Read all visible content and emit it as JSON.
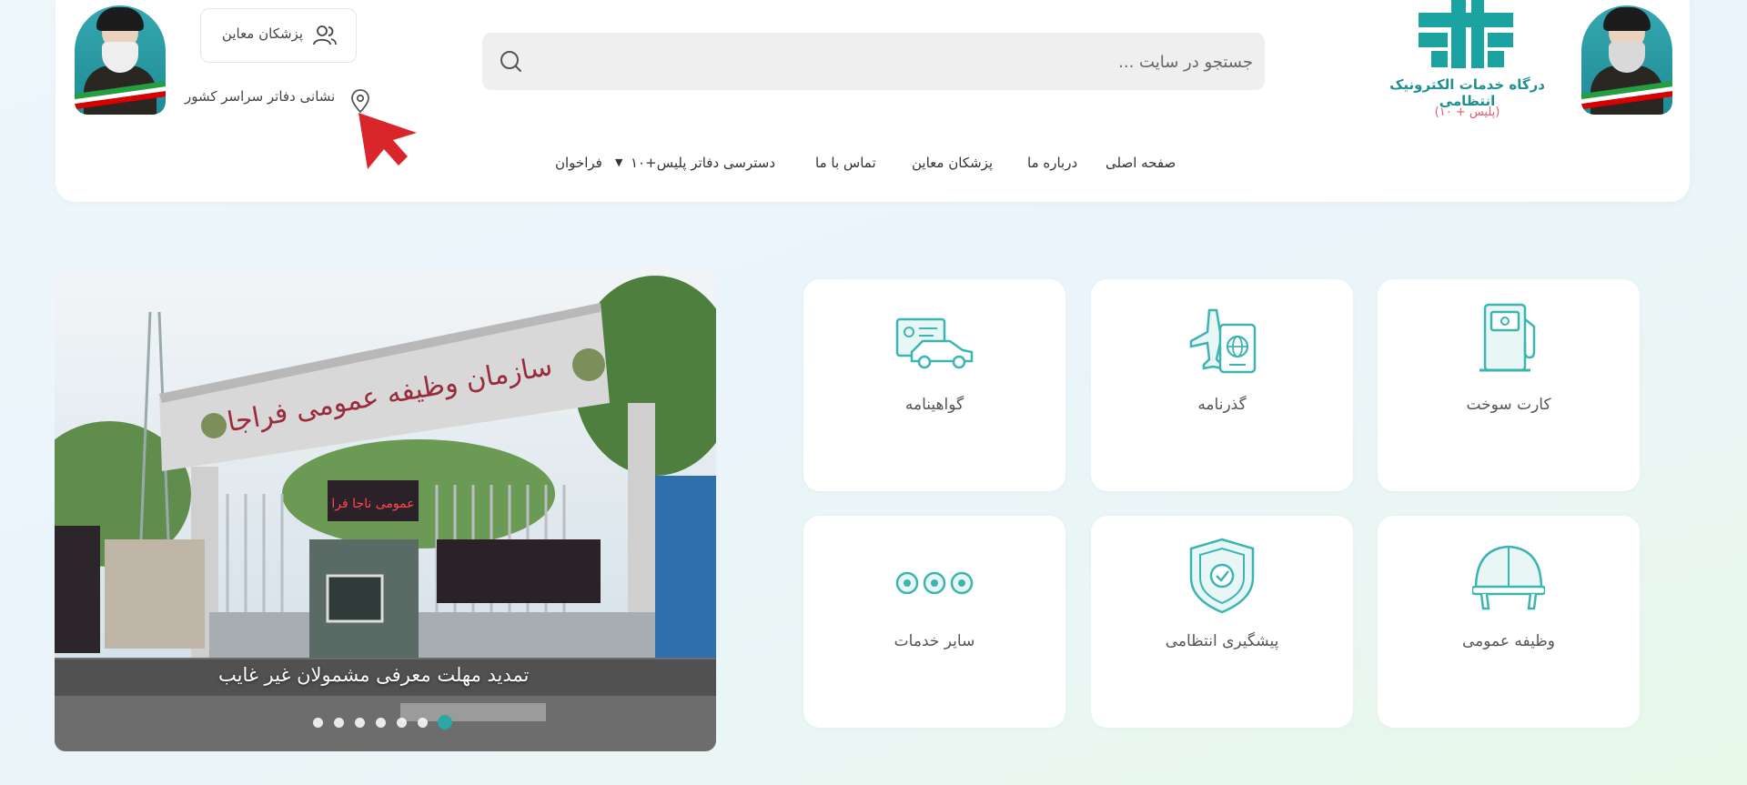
{
  "brand": {
    "title": "درگاه خدمات الکترونیک انتظامی",
    "subtitle": "(پلیس + ۱۰)"
  },
  "search": {
    "placeholder": "جستجو در سایت ..."
  },
  "nav": {
    "home": "صفحه اصلی",
    "about": "درباره ما",
    "doctors": "پزشکان معاین",
    "contact": "تماس با ما",
    "access": "دسترسی دفاتر پلیس+۱۰",
    "calls": "فراخوان"
  },
  "top": {
    "doctors_button": "پزشکان معاین",
    "offices_link": "نشانی دفاتر سراسر کشور"
  },
  "services": [
    {
      "label": "کارت سوخت",
      "icon": "fuel-pump-icon"
    },
    {
      "label": "گذرنامه",
      "icon": "passport-plane-icon"
    },
    {
      "label": "گواهینامه",
      "icon": "license-car-icon"
    },
    {
      "label": "وظیفه عمومی",
      "icon": "helmet-icon"
    },
    {
      "label": "پیشگیری انتظامی",
      "icon": "shield-check-icon"
    },
    {
      "label": "سایر خدمات",
      "icon": "more-dots-icon"
    }
  ],
  "slider": {
    "caption": "تمدید مهلت معرفی مشمولان غیر غایب",
    "sign_text": "سازمان وظیفه عمومی فراجا",
    "display_text": "عمومی ناجا فرا",
    "slide_count": 7,
    "active_slide": 7
  },
  "colors": {
    "accent": "#1aa3a0",
    "brand_red": "#e25b6a",
    "cursor_red": "#d9262b"
  }
}
